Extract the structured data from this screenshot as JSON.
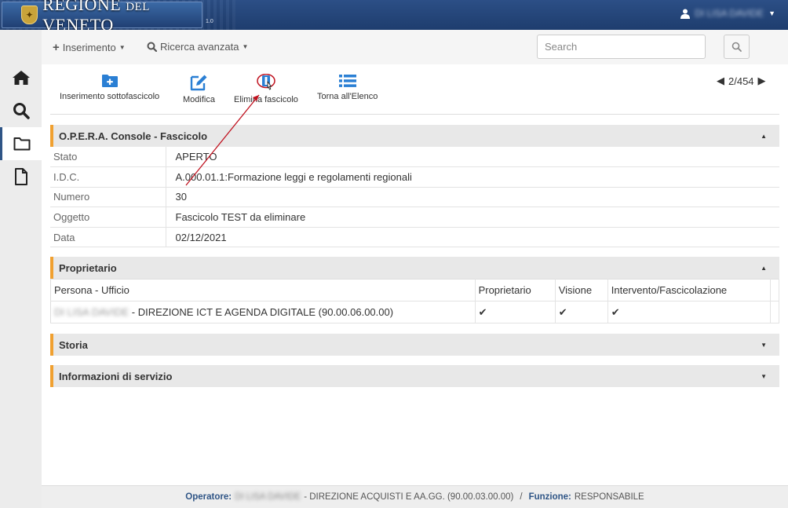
{
  "app": {
    "brand": "REGIONE",
    "brand_small": "DEL",
    "brand_end": "VENETO",
    "version": "1.0",
    "user_name": "DI LISA DAVIDE"
  },
  "search_bar": {
    "inserimento": "Inserimento",
    "ricerca": "Ricerca avanzata",
    "search_placeholder": "Search"
  },
  "toolbar": {
    "items": [
      {
        "label": "Inserimento sottofascicolo",
        "icon": "folder-plus-icon"
      },
      {
        "label": "Modifica",
        "icon": "edit-icon"
      },
      {
        "label": "Elimina fascicolo",
        "icon": "trash-icon"
      },
      {
        "label": "Torna all'Elenco",
        "icon": "list-icon"
      }
    ],
    "pager": "2/454"
  },
  "fascicolo": {
    "title": "O.P.E.R.A. Console - Fascicolo",
    "rows": [
      {
        "key": "Stato",
        "value": "APERTO"
      },
      {
        "key": "I.D.C.",
        "value": "A.000.01.1:Formazione leggi e regolamenti regionali"
      },
      {
        "key": "Numero",
        "value": "30"
      },
      {
        "key": "Oggetto",
        "value": "Fascicolo TEST da eliminare"
      },
      {
        "key": "Data",
        "value": "02/12/2021"
      }
    ]
  },
  "proprietario": {
    "title": "Proprietario",
    "headers": [
      "Persona - Ufficio",
      "Proprietario",
      "Visione",
      "Intervento/Fascicolazione"
    ],
    "row": {
      "person": "DI LISA DAVIDE",
      "office": " - DIREZIONE ICT E AGENDA DIGITALE  (90.00.06.00.00)",
      "proprietario": "✔",
      "visione": "✔",
      "intervento": "✔"
    }
  },
  "storia": {
    "title": "Storia"
  },
  "info": {
    "title": "Informazioni di servizio"
  },
  "footer": {
    "operatore_label": "Operatore:",
    "operatore_name": "DI LISA DAVIDE",
    "operatore_office": "- DIREZIONE ACQUISTI E AA.GG. (90.00.03.00.00)",
    "slash": "/",
    "funzione_label": "Funzione:",
    "funzione_value": "RESPONSABILE"
  },
  "colors": {
    "brand_blue": "#2f5586",
    "icon_blue": "#2a7fd4",
    "panel_accent": "#f0a030",
    "annotation": "#c0121f"
  }
}
